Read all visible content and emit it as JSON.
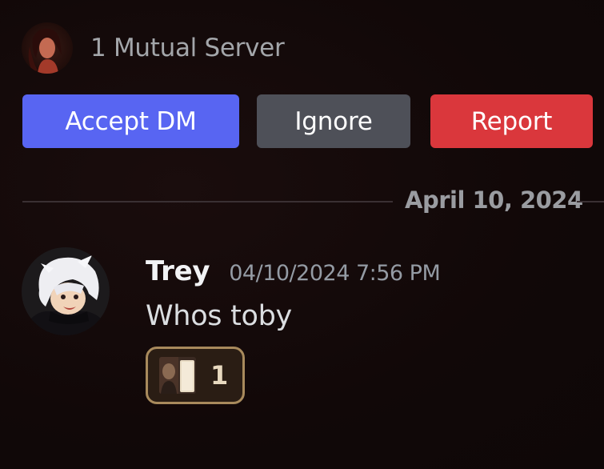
{
  "mutual": {
    "text": "1 Mutual Server"
  },
  "actions": {
    "accept_label": "Accept DM",
    "ignore_label": "Ignore",
    "report_label": "Report"
  },
  "colors": {
    "accept": "#5865f2",
    "ignore": "#4e5058",
    "report": "#da373c",
    "reaction_border": "#a88a5c"
  },
  "divider": {
    "date": "April 10, 2024"
  },
  "message": {
    "username": "Trey",
    "timestamp": "04/10/2024 7:56 PM",
    "content": "Whos toby",
    "reaction": {
      "icon": "custom-emoji-icon",
      "count": "1"
    }
  }
}
